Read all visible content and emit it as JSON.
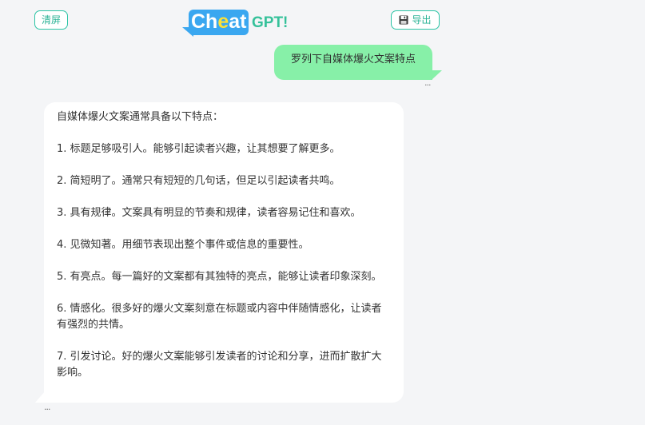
{
  "toolbar": {
    "clear_label": "清屏",
    "export_label": "导出",
    "export_icon": "save-icon"
  },
  "logo": {
    "cheat_prefix": "Ch",
    "cheat_highlight": "e",
    "cheat_suffix": "at",
    "gpt": "GPT!"
  },
  "colors": {
    "accent": "#2bc4a5",
    "user_bubble": "#87f0a8",
    "logo_blue": "#3aa7f0",
    "logo_yellow": "#ffe135",
    "logo_green": "#35c19a"
  },
  "messages": {
    "user": {
      "text": "罗列下自媒体爆火文案特点",
      "more": "···"
    },
    "bot": {
      "lines": [
        "自媒体爆火文案通常具备以下特点：",
        "1. 标题足够吸引人。能够引起读者兴趣，让其想要了解更多。",
        "2. 简短明了。通常只有短短的几句话，但足以引起读者共鸣。",
        "3. 具有规律。文案具有明显的节奏和规律，读者容易记住和喜欢。",
        "4. 见微知著。用细节表现出整个事件或信息的重要性。",
        "5. 有亮点。每一篇好的文案都有其独特的亮点，能够让读者印象深刻。",
        "6. 情感化。很多好的爆火文案刻意在标题或内容中伴随情感化，让读者有强烈的共情。",
        "7. 引发讨论。好的爆火文案能够引发读者的讨论和分享，进而扩散扩大影响。"
      ],
      "more": "···"
    }
  }
}
